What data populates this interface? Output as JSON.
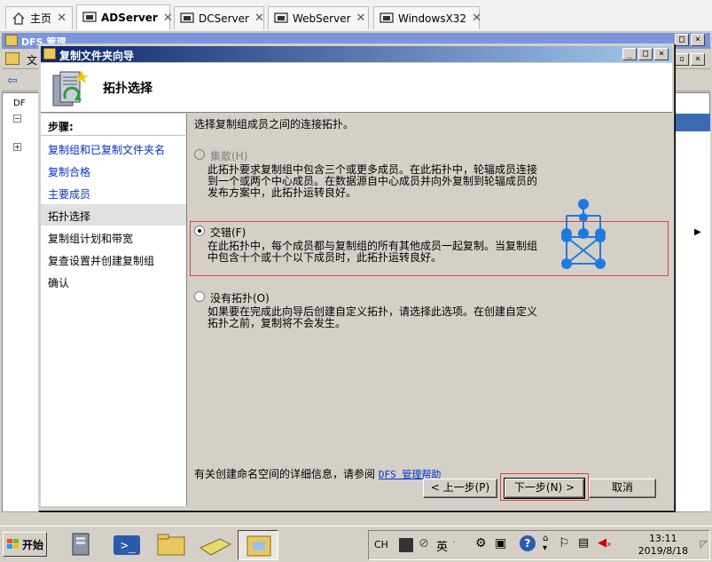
{
  "tabs": [
    {
      "label": "主页",
      "icon": "home-icon",
      "active": false
    },
    {
      "label": "ADServer",
      "icon": "vm-icon",
      "active": true
    },
    {
      "label": "DCServer",
      "icon": "vm-icon",
      "active": false
    },
    {
      "label": "WebServer",
      "icon": "vm-icon",
      "active": false
    },
    {
      "label": "WindowsX32",
      "icon": "vm-icon",
      "active": false
    }
  ],
  "mmc": {
    "title": "DFS 管理",
    "menu_first": "文",
    "tree_item": "DF"
  },
  "dialog": {
    "title": "复制文件夹向导",
    "header_title": "拓扑选择",
    "steps_heading": "步骤:",
    "steps": [
      {
        "label": "复制组和已复制文件夹名",
        "state": "link"
      },
      {
        "label": "复制合格",
        "state": "link"
      },
      {
        "label": "主要成员",
        "state": "link"
      },
      {
        "label": "拓扑选择",
        "state": "current"
      },
      {
        "label": "复制组计划和带宽",
        "state": "pending"
      },
      {
        "label": "复查设置并创建复制组",
        "state": "pending"
      },
      {
        "label": "确认",
        "state": "pending"
      }
    ],
    "intro": "选择复制组成员之间的连接拓扑。",
    "options": [
      {
        "label": "集散(H)",
        "checked": false,
        "disabled": true,
        "desc_lines": [
          "此拓扑要求复制组中包含三个或更多成员。在此拓扑中，轮辐成员连接",
          "到一个或两个中心成员。在数据源自中心成员并向外复制到轮辐成员的",
          "发布方案中，此拓扑运转良好。"
        ],
        "icon": "hub-spoke-topology-icon"
      },
      {
        "label": "交错(F)",
        "checked": true,
        "disabled": false,
        "desc_lines": [
          "在此拓扑中，每个成员都与复制组的所有其他成员一起复制。当复制组",
          "中包含十个或十个以下成员时，此拓扑运转良好。"
        ],
        "icon": "full-mesh-topology-icon"
      },
      {
        "label": "没有拓扑(O)",
        "checked": false,
        "disabled": false,
        "desc_lines": [
          "如果要在完成此向导后创建自定义拓扑，请选择此选项。在创建自定义",
          "拓扑之前，复制将不会发生。"
        ],
        "icon": ""
      }
    ],
    "help_text": "有关创建命名空间的详细信息，请参阅",
    "help_link": "DFS 管理帮助",
    "buttons": {
      "back": "< 上一步(P)",
      "next": "下一步(N) >",
      "cancel": "取消"
    },
    "colors": {
      "title_start": "#0a246a",
      "title_end": "#a6caf0",
      "topology_blue": "#1e7ae0",
      "highlight_red": "#e04040"
    }
  },
  "taskbar": {
    "start_label": "开始",
    "lang": "CH",
    "ime": "英",
    "time": "13:11",
    "date": "2019/8/18"
  }
}
